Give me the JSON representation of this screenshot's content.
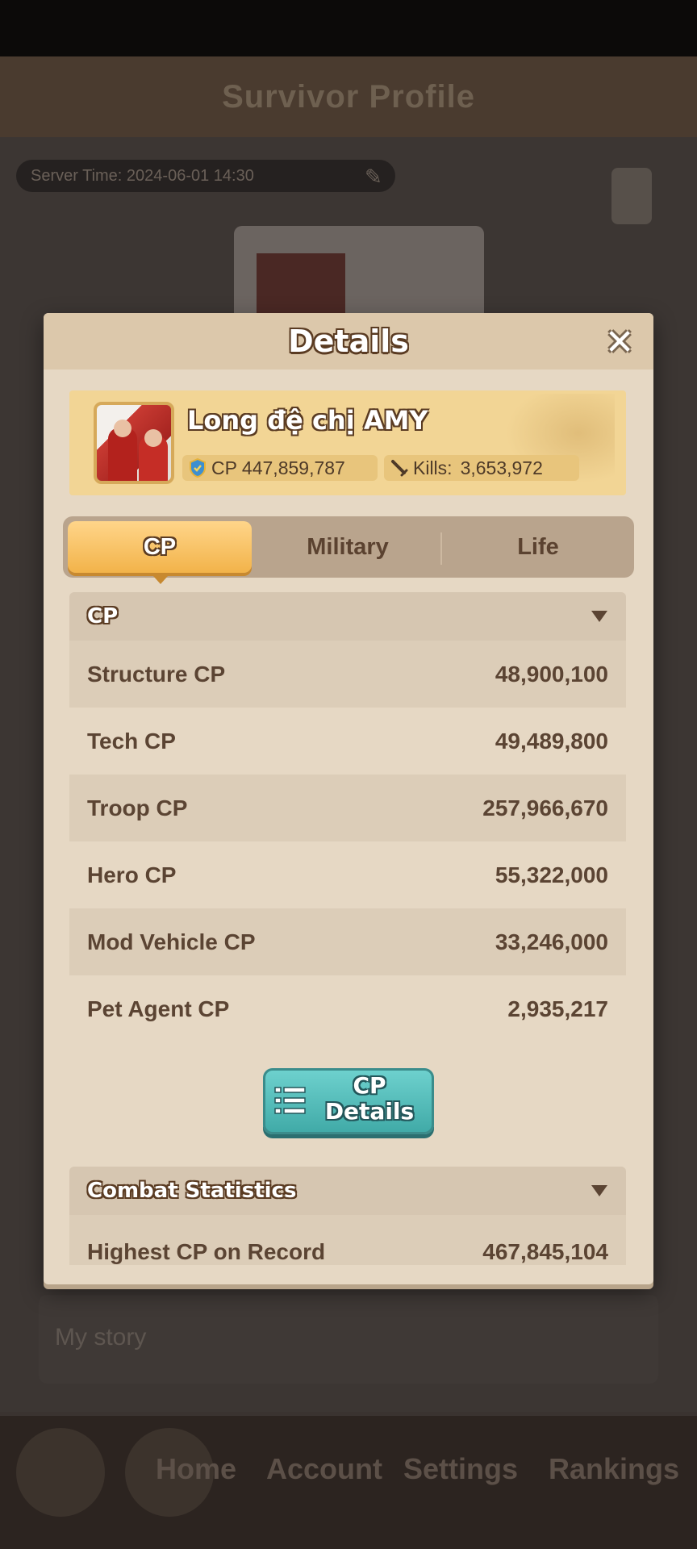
{
  "background": {
    "header_title": "Survivor Profile",
    "server_time": "Server Time: 2024-06-01 14:30",
    "bottom_field": "My story",
    "nav": [
      "Home",
      "Account",
      "Settings",
      "Rankings"
    ]
  },
  "modal": {
    "title": "Details",
    "player": {
      "name": "Long đệ chị AMY",
      "cp": "CP 447,859,787",
      "kills_label": "Kills:",
      "kills_value": "3,653,972"
    },
    "tabs": [
      "CP",
      "Military",
      "Life"
    ],
    "active_tab": "CP",
    "cp_section": {
      "title": "CP",
      "rows": [
        {
          "label": "Structure CP",
          "value": "48,900,100"
        },
        {
          "label": "Tech CP",
          "value": "49,489,800"
        },
        {
          "label": "Troop CP",
          "value": "257,966,670"
        },
        {
          "label": "Hero CP",
          "value": "55,322,000"
        },
        {
          "label": "Mod Vehicle CP",
          "value": "33,246,000"
        },
        {
          "label": "Pet Agent CP",
          "value": "2,935,217"
        }
      ],
      "details_button": "CP Details"
    },
    "combat_section": {
      "title": "Combat Statistics",
      "rows": [
        {
          "label": "Highest CP on Record",
          "value": "467,845,104"
        }
      ]
    }
  },
  "colors": {
    "modal_bg": "#e6d8c4",
    "banner_bg": "#f2d595",
    "active_tab": "#f2b34a",
    "button_teal": "#4fbcb9",
    "text_brown": "#5b4433"
  }
}
